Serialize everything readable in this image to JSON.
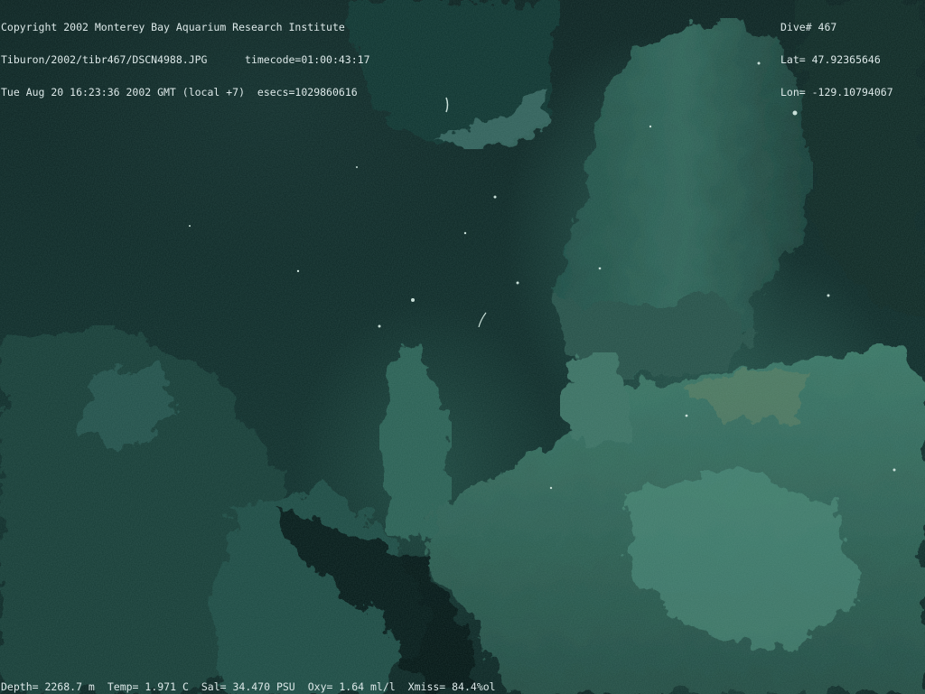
{
  "overlay": {
    "top_left": {
      "copyright": "Copyright 2002 Monterey Bay Aquarium Research Institute",
      "file_path": "Tiburon/2002/tibr467/DSCN4988.JPG",
      "timecode": "timecode=01:00:43:17",
      "datetime": "Tue Aug 20 16:23:36 2002 GMT (local +7)",
      "esecs": "esecs=1029860616"
    },
    "top_right": {
      "dive": "Dive# 467",
      "lat": "Lat= 47.92365646",
      "lon": "Lon= -129.10794067"
    },
    "bottom": {
      "depth": "Depth= 2268.7 m",
      "temp": "Temp= 1.971 C",
      "sal": "Sal= 34.470 PSU",
      "oxy": "Oxy= 1.64 ml/l",
      "xmiss": "Xmiss= 84.4%ol"
    }
  },
  "colors": {
    "overlay_text": "#dce8e8",
    "water": "#0c2725",
    "rock_highlight": "#4f8f7e"
  }
}
